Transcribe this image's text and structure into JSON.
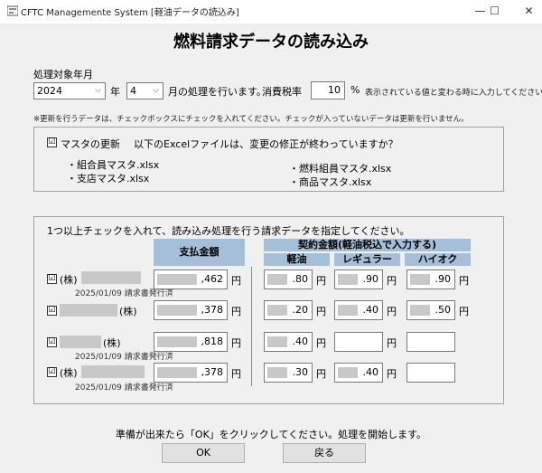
{
  "window": {
    "title": "CFTC Managemente System [軽油データの読込み]",
    "minimize": "—",
    "maximize": "☐",
    "close": "✕"
  },
  "page_title": "燃料請求データの読み込み",
  "period": {
    "label": "処理対象年月",
    "year": "2024",
    "year_unit": "年",
    "month": "4",
    "month_suffix": "月の処理を行います。"
  },
  "tax": {
    "label": "消費税率",
    "value": "10",
    "unit": "%",
    "note": "表示されている値と変わる時に入力してください。"
  },
  "update_note": "※更新を行うデータは、チェックボックスにチェックを入れてください。チェックが入っていないデータは更新を行いません。",
  "master": {
    "checkbox_label": "マスタの更新",
    "question": "以下のExcelファイルは、変更の修正が終わっていますか？",
    "files_left": [
      "・組合員マスタ.xlsx",
      "・支店マスタ.xlsx"
    ],
    "files_right": [
      "・燃料組員マスタ.xlsx",
      "・商品マスタ.xlsx"
    ]
  },
  "billing": {
    "instruction": "1つ以上チェックを入れて、読み込み処理を行う請求データを指定してください。",
    "header_payment": "支払金額",
    "header_contract": "契約金額(軽油税込で入力する)",
    "col_diesel": "軽油",
    "col_regular": "レギュラー",
    "col_hioctane": "ハイオク",
    "yen": "円",
    "rows": [
      {
        "company": "(株)",
        "sub": "2025/01/09 請求書発行済",
        "payment": ",462",
        "diesel": ".80",
        "regular": ".90",
        "hioctane": ".90"
      },
      {
        "company": "(株)",
        "sub": "",
        "payment": ",378",
        "diesel": ".20",
        "regular": ".40",
        "hioctane": ".50"
      },
      {
        "company": "(株)",
        "sub": "2025/01/09 請求書発行済",
        "payment": ",818",
        "diesel": ".40",
        "regular": "",
        "hioctane": ""
      },
      {
        "company": "(株)",
        "sub": "2025/01/09 請求書発行済",
        "payment": ",378",
        "diesel": ".30",
        "regular": ".40",
        "hioctane": ""
      }
    ]
  },
  "footer": {
    "message": "準備が出来たら「OK」をクリックしてください。処理を開始します。",
    "ok": "OK",
    "back": "戻る"
  },
  "check_mark": "☑"
}
